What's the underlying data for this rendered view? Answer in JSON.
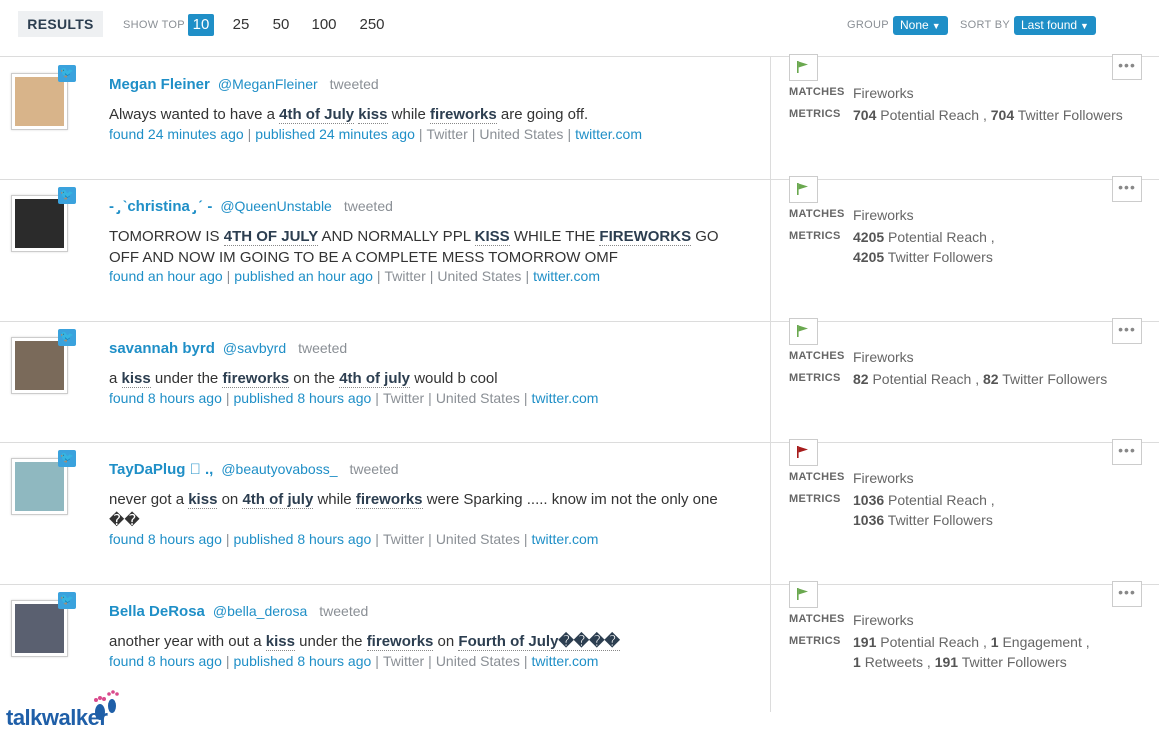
{
  "toolbar": {
    "results_label": "RESULTS",
    "show_top_label": "SHOW TOP",
    "show_top_options": [
      "10",
      "25",
      "50",
      "100",
      "250"
    ],
    "show_top_selected": "10",
    "group_label": "GROUP",
    "group_value": "None",
    "sort_label": "SORT BY",
    "sort_value": "Last found"
  },
  "results": [
    {
      "name": "Megan Fleiner",
      "handle": "@MeganFleiner",
      "verb": "tweeted",
      "text_parts": [
        "Always wanted to have a ",
        "4th of July",
        " ",
        "kiss",
        " while ",
        "fireworks",
        " are going off."
      ],
      "found": "found 24 minutes ago",
      "published": "published 24 minutes ago",
      "source": "Twitter",
      "country": "United States",
      "domain": "twitter.com",
      "matches_label": "MATCHES",
      "matches": "Fireworks",
      "metrics_label": "METRICS",
      "metrics_line1": [
        {
          "num": "704",
          "label": "Potential Reach ,"
        },
        {
          "num": "704",
          "label": "Twitter Followers"
        }
      ],
      "metrics_line2": [],
      "flag_color": "#6aa84f",
      "avatar_color": "#d8b48a"
    },
    {
      "name": "‐ ̡ ˋchristina ̡ ˊ ‐",
      "handle": "@QueenUnstable",
      "verb": "tweeted",
      "text_parts": [
        "TOMORROW IS ",
        "4TH OF JULY",
        " AND NORMALLY PPL ",
        "KISS",
        " WHILE THE ",
        "FIREWORKS",
        " GO OFF AND NOW IM GOING TO BE A COMPLETE MESS TOMORROW OMF"
      ],
      "found": "found an hour ago",
      "published": "published an hour ago",
      "source": "Twitter",
      "country": "United States",
      "domain": "twitter.com",
      "matches_label": "MATCHES",
      "matches": "Fireworks",
      "metrics_label": "METRICS",
      "metrics_line1": [
        {
          "num": "4205",
          "label": "Potential Reach ,"
        }
      ],
      "metrics_line2": [
        {
          "num": "4205",
          "label": "Twitter Followers"
        }
      ],
      "flag_color": "#6aa84f",
      "avatar_color": "#2b2b2b"
    },
    {
      "name": "savannah byrd",
      "handle": "@savbyrd",
      "verb": "tweeted",
      "text_parts": [
        "a ",
        "kiss",
        " under the ",
        "fireworks",
        " on the ",
        "4th of july",
        " would b cool"
      ],
      "found": "found 8 hours ago",
      "published": "published 8 hours ago",
      "source": "Twitter",
      "country": "United States",
      "domain": "twitter.com",
      "matches_label": "MATCHES",
      "matches": "Fireworks",
      "metrics_label": "METRICS",
      "metrics_line1": [
        {
          "num": "82",
          "label": "Potential Reach ,"
        },
        {
          "num": "82",
          "label": "Twitter Followers"
        }
      ],
      "metrics_line2": [],
      "flag_color": "#6aa84f",
      "avatar_color": "#7a6a5a"
    },
    {
      "name": "TayDaPlug ⃞ .,",
      "handle": "@beautyovaboss_",
      "verb": "tweeted",
      "text_parts": [
        "never got a ",
        "kiss",
        " on ",
        "4th of july",
        " while ",
        "fireworks",
        " were Sparking ..... know im not the only one ��"
      ],
      "found": "found 8 hours ago",
      "published": "published 8 hours ago",
      "source": "Twitter",
      "country": "United States",
      "domain": "twitter.com",
      "matches_label": "MATCHES",
      "matches": "Fireworks",
      "metrics_label": "METRICS",
      "metrics_line1": [
        {
          "num": "1036",
          "label": "Potential Reach ,"
        }
      ],
      "metrics_line2": [
        {
          "num": "1036",
          "label": "Twitter Followers"
        }
      ],
      "flag_color": "#a61c1c",
      "avatar_color": "#8fb8c0"
    },
    {
      "name": "Bella DeRosa",
      "handle": "@bella_derosa",
      "verb": "tweeted",
      "text_parts": [
        "another year with out a ",
        "kiss",
        " under the ",
        "fireworks",
        " on ",
        "Fourth of July����",
        ""
      ],
      "found": "found 8 hours ago",
      "published": "published 8 hours ago",
      "source": "Twitter",
      "country": "United States",
      "domain": "twitter.com",
      "matches_label": "MATCHES",
      "matches": "Fireworks",
      "metrics_label": "METRICS",
      "metrics_line1": [
        {
          "num": "191",
          "label": "Potential Reach ,"
        },
        {
          "num": "1",
          "label": "Engagement ,"
        }
      ],
      "metrics_line2": [
        {
          "num": "1",
          "label": "Retweets ,"
        },
        {
          "num": "191",
          "label": "Twitter Followers"
        }
      ],
      "flag_color": "#6aa84f",
      "avatar_color": "#5a6070"
    }
  ],
  "logo": {
    "text": "talkwalker",
    "color": "#1f5fa8"
  },
  "icons": {
    "twitter": "twitter-bird-icon",
    "flag": "flag-icon",
    "more": "more-dots-icon"
  }
}
